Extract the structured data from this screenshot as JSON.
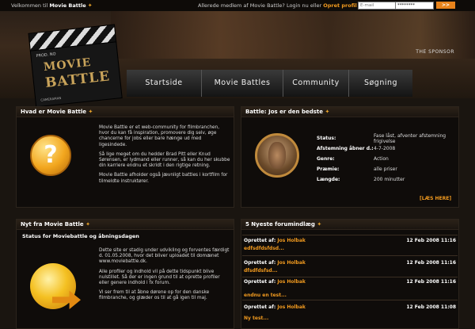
{
  "topbar": {
    "welcome_prefix": "Velkommen til ",
    "welcome_brand": "Movie Battle",
    "member_text": "Allerede medlem af Movie Battle? Login nu eller ",
    "signup_link": "Opret profil",
    "email_placeholder": "E-mail",
    "password_value": "********",
    "go_label": ">>"
  },
  "logo": {
    "prod": "PROD. NO",
    "line1": "MOVIE",
    "line2": "BATTLE",
    "camera": "CAMERAMAN"
  },
  "sponsor": "THE SPONSOR",
  "nav": [
    "Startside",
    "Movie Battles",
    "Community",
    "Søgning"
  ],
  "about": {
    "title": "Hvad er Movie Battle",
    "p1": "Movie Battle er et web-community for filmbranchen, hvor du kan få inspiration, promovere dig selv, øge chancerne for jobs eller bare hænge ud med ligesindede.",
    "p2": "Så lige meget om du hedder Brad Pitt eller Knud Sørensen, er lydmand eller runner, så kan du her skubbe din karriere endnu et skridt i den rigtige retning.",
    "p3": "Movie Battle afholder også jævnligt battles i kortfilm for tilmeldte instruktører."
  },
  "battle": {
    "title": "Battle: Jos er den bedste",
    "rows": [
      {
        "label": "Status:",
        "value": "Fase låst, afventer afstemning frigivelse"
      },
      {
        "label": "Afstemning åbner d.:",
        "value": "4-7-2008"
      },
      {
        "label": "Genre:",
        "value": "Action"
      },
      {
        "label": "Præmie:",
        "value": "alle priser"
      },
      {
        "label": "Længde:",
        "value": "200 minutter"
      }
    ],
    "read_more": "[LÆS HERE]"
  },
  "news": {
    "title": "Nyt fra Movie Battle",
    "subtitle": "Status for Moviebattle og åbningsdagen",
    "p1": "Dette site er stadig under udvikling og forventes færdigt d. 01.05.2008, hvor det bliver uploadet til domænet www.moviebattle.dk.",
    "p2": "Alle profiler og indhold vil på dette tidspunkt blive nulstillet. Så der er ingen grund til at oprette profiler eller genere indhold i fx forum.",
    "p3": "Vi ser frem til at åbne dørene op for den danske filmbranche, og glæder os til at gå igen til maj."
  },
  "forum": {
    "title": "5 Nyeste forumindlæg",
    "posts": [
      {
        "by": "Oprettet af:",
        "user": "Jos Holbak",
        "date": "12 Feb 2008 11:16",
        "text": "edfsdfdsfdsd..."
      },
      {
        "by": "Oprettet af:",
        "user": "Jos Holbak",
        "date": "12 Feb 2008 11:16",
        "text": "dfsdfdsfsd..."
      },
      {
        "by": "Oprettet af:",
        "user": "Jos Holbak",
        "date": "12 Feb 2008 11:16",
        "text": "endnu en test..."
      },
      {
        "by": "Oprettet af:",
        "user": "Jos Holbak",
        "date": "12 Feb 2008 11:08",
        "text": "Ny test..."
      }
    ]
  },
  "colors": {
    "accent": "#f19a1f",
    "background": "#1a1510"
  },
  "icons": [
    "question-icon",
    "globe-icon",
    "arrow-icon",
    "battle-thumbnail"
  ]
}
